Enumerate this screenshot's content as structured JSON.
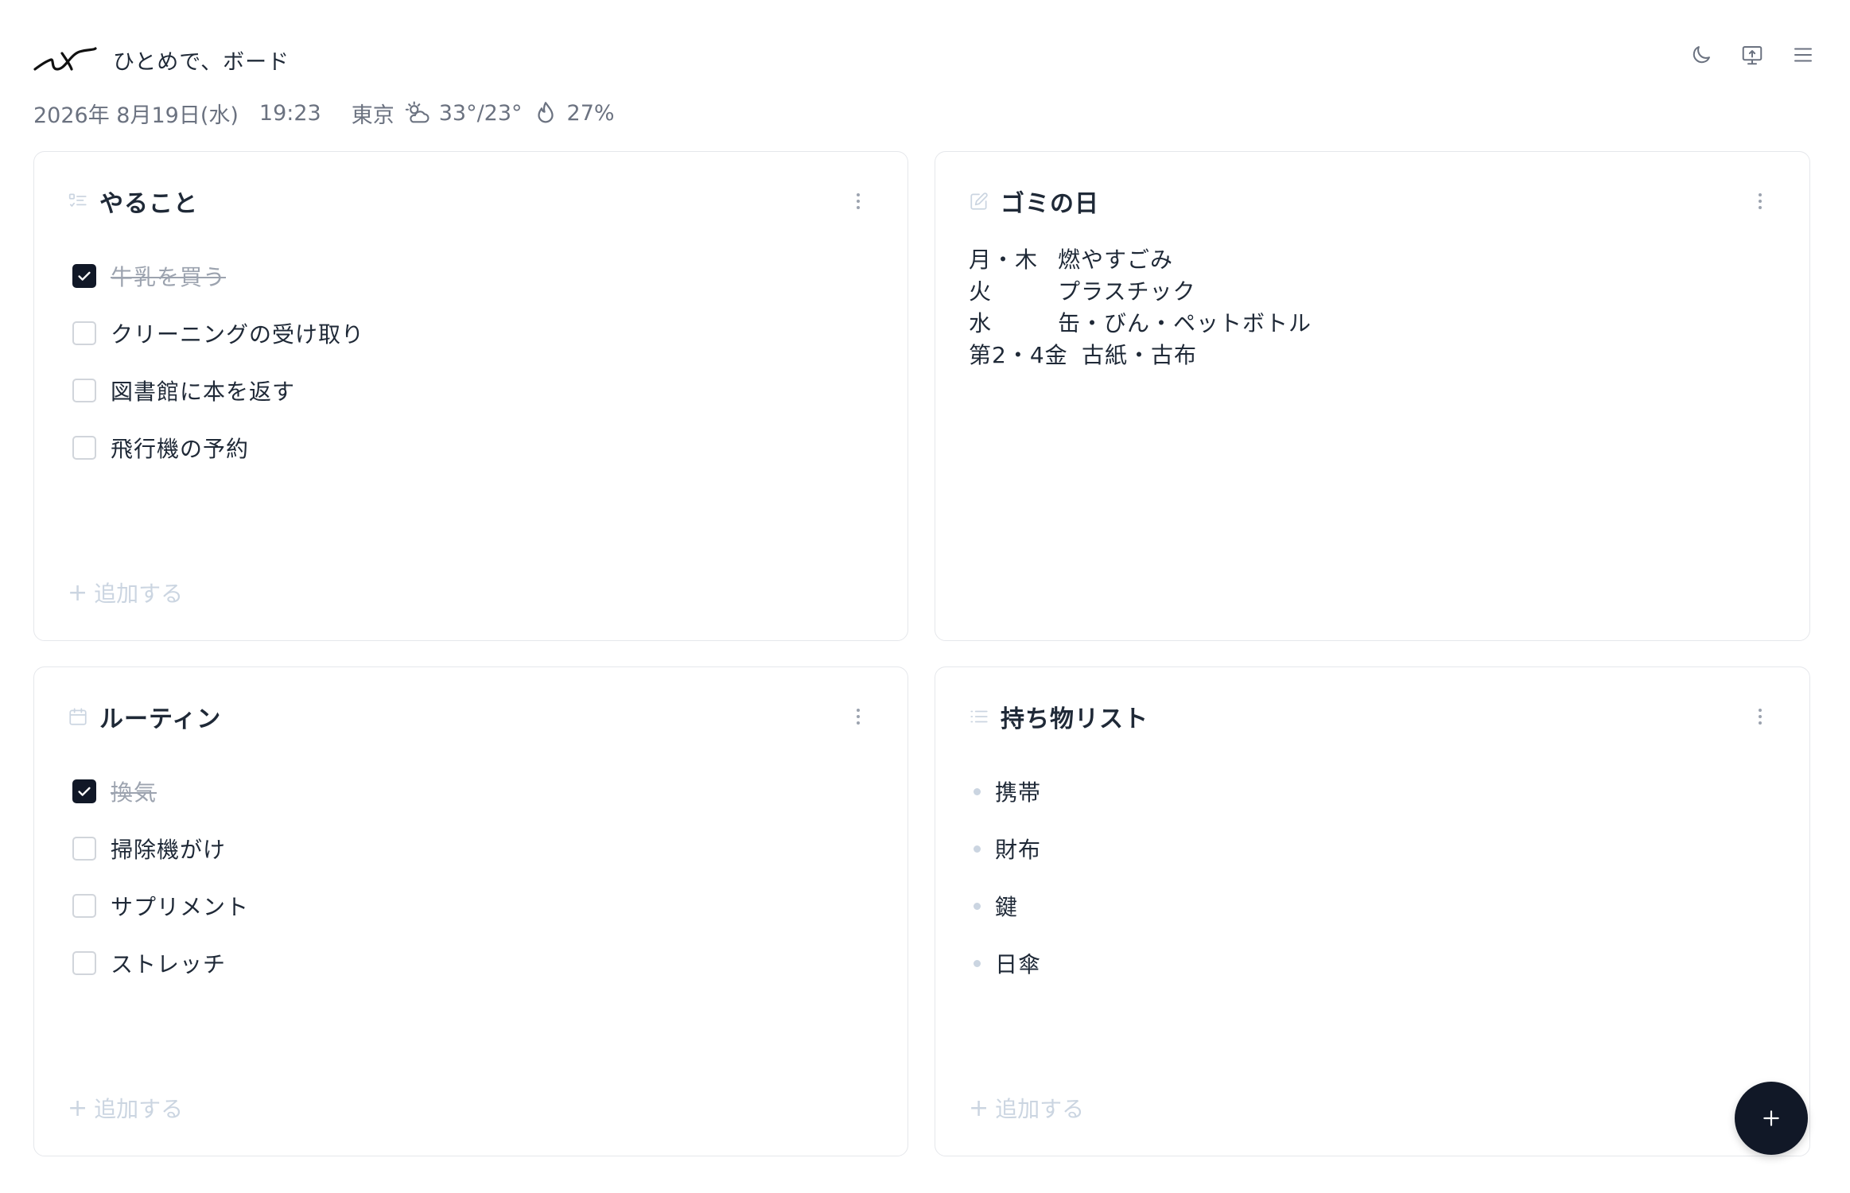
{
  "app": {
    "title": "ひとめで、ボード"
  },
  "header": {
    "date": "2026年 8月19日(水)",
    "time": "19:23",
    "city": "東京",
    "temp": "33°/23°",
    "humidity": "27%",
    "icons": [
      "moon-icon",
      "display-upload-icon",
      "menu-icon"
    ]
  },
  "cards": {
    "todo": {
      "title": "やること",
      "icon": "checklist-icon",
      "items": [
        {
          "label": "牛乳を買う",
          "checked": true
        },
        {
          "label": "クリーニングの受け取り",
          "checked": false
        },
        {
          "label": "図書館に本を返す",
          "checked": false
        },
        {
          "label": "飛行機の予約",
          "checked": false
        }
      ],
      "add_label": "追加する"
    },
    "garbage": {
      "title": "ゴミの日",
      "icon": "note-edit-icon",
      "rows": [
        {
          "day": "月・木",
          "kind": "燃やすごみ"
        },
        {
          "day": "火",
          "kind": "プラスチック"
        },
        {
          "day": "水",
          "kind": "缶・びん・ペットボトル"
        },
        {
          "day": "第2・4金",
          "kind": "古紙・古布"
        }
      ]
    },
    "routine": {
      "title": "ルーティン",
      "icon": "calendar-icon",
      "items": [
        {
          "label": "換気",
          "checked": true
        },
        {
          "label": "掃除機がけ",
          "checked": false
        },
        {
          "label": "サプリメント",
          "checked": false
        },
        {
          "label": "ストレッチ",
          "checked": false
        }
      ],
      "add_label": "追加する"
    },
    "belongings": {
      "title": "持ち物リスト",
      "icon": "list-icon",
      "items": [
        "携帯",
        "財布",
        "鍵",
        "日傘"
      ],
      "add_label": "追加する"
    }
  },
  "colors": {
    "accent": "#111827",
    "muted": "#6b7280",
    "border": "#e5e7eb",
    "placeholder": "#cbd5e1"
  }
}
